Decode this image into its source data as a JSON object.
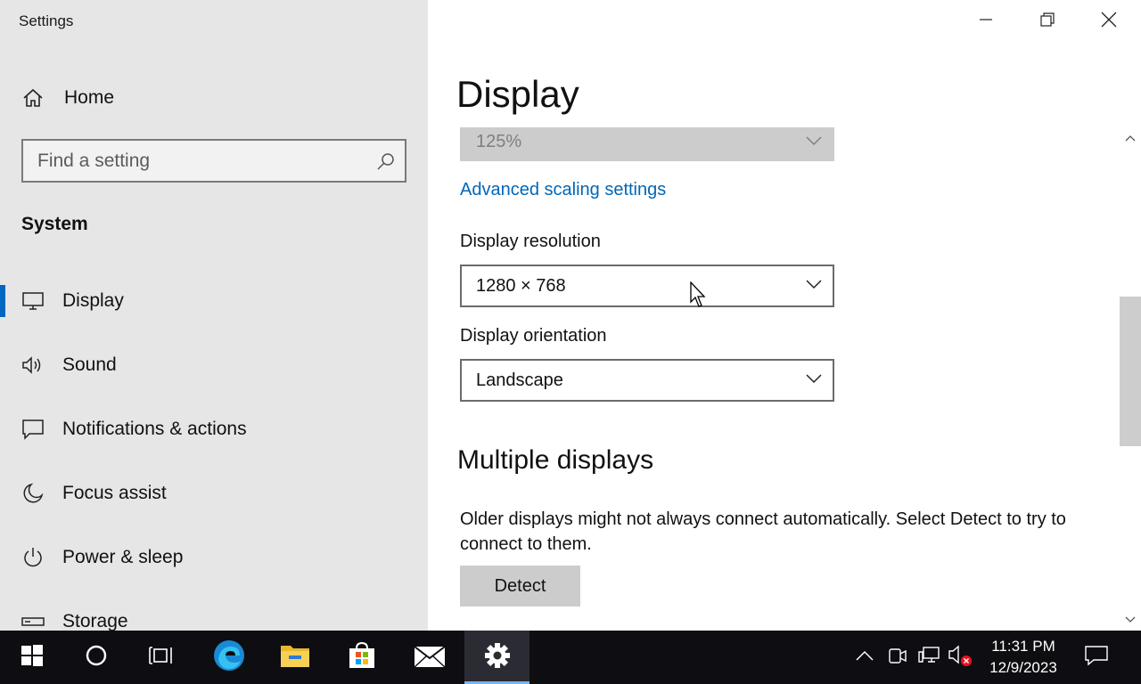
{
  "window": {
    "app_title": "Settings",
    "minimize_icon": "minimize-icon",
    "restore_icon": "restore-icon",
    "close_icon": "close-icon"
  },
  "sidebar": {
    "home_label": "Home",
    "search_placeholder": "Find a setting",
    "section_title": "System",
    "items": [
      {
        "label": "Display",
        "icon": "monitor-icon",
        "active": true
      },
      {
        "label": "Sound",
        "icon": "speaker-icon",
        "active": false
      },
      {
        "label": "Notifications & actions",
        "icon": "message-icon",
        "active": false
      },
      {
        "label": "Focus assist",
        "icon": "moon-icon",
        "active": false
      },
      {
        "label": "Power & sleep",
        "icon": "power-icon",
        "active": false
      },
      {
        "label": "Storage",
        "icon": "storage-icon",
        "active": false
      }
    ]
  },
  "main": {
    "page_title": "Display",
    "scale_value": "125%",
    "advanced_scaling_link": "Advanced scaling settings",
    "resolution_label": "Display resolution",
    "resolution_value": "1280 × 768",
    "orientation_label": "Display orientation",
    "orientation_value": "Landscape",
    "multiple_displays_title": "Multiple displays",
    "multiple_displays_desc": "Older displays might not always connect automatically. Select Detect to try to connect to them.",
    "detect_button": "Detect"
  },
  "taskbar": {
    "apps": [
      "start-icon",
      "cortana-icon",
      "task-view-icon",
      "edge-icon",
      "file-explorer-icon",
      "store-icon",
      "mail-icon",
      "settings-icon"
    ],
    "tray": [
      "show-hidden-icons-icon",
      "meet-now-icon",
      "network-icon",
      "volume-muted-icon"
    ],
    "time": "11:31 PM",
    "date": "12/9/2023",
    "notification_icon": "action-center-icon"
  },
  "colors": {
    "accent": "#0067c0",
    "link": "#0067b8",
    "sidebar_bg": "#e6e6e6",
    "taskbar_bg": "#0e0e12"
  }
}
